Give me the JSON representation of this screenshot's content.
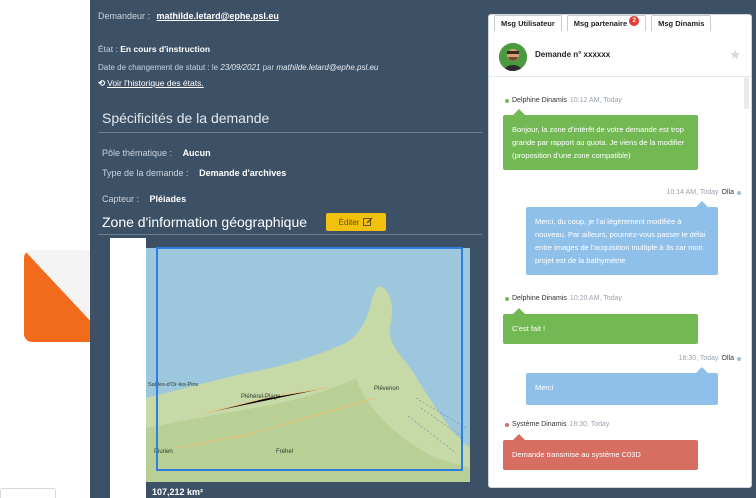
{
  "request": {
    "requester_label": "Demandeur :",
    "requester_email": "mathilde.letard@ephe.psl.eu",
    "state_label": "État :",
    "state_value": "En cours d'instruction",
    "date_prefix": "Date de changement de statut : le",
    "date_value": "23/09/2021",
    "date_by": "par",
    "date_author": "mathilde.letard@ephe.psl.eu",
    "history_link": "Voir l'historique des états."
  },
  "specs": {
    "title": "Spécificités de la demande",
    "theme_label": "Pôle thématique :",
    "theme_value": "Aucun",
    "type_label": "Type de la demande :",
    "type_value": "Demande d'archives",
    "sensor_label": "Capteur :",
    "sensor_value": "Pléiades"
  },
  "geo": {
    "title": "Zone d'information géographique",
    "edit_label": "Éditer",
    "area_value": "107,212 km²",
    "map_places": [
      "Plévenon",
      "Pléhérel-Plage",
      "Sables-d'Or-les-Pins",
      "Plurien",
      "Fréhel"
    ]
  },
  "tabs": [
    {
      "label": "Msg Utilisateur",
      "badge": null
    },
    {
      "label": "Msg partenaire",
      "badge": "2"
    },
    {
      "label": "Msg Dinamis",
      "badge": null
    }
  ],
  "chat": {
    "title": "Demande n° xxxxxx",
    "messages": [
      {
        "author": "Delphine Dinamis",
        "time": "10:12 AM, Today",
        "text": "Bonjour, la zone d'intérêt de votre demande est trop grande par rapport au quota. Je viens de la modifier (proposition d'une zone compatible)",
        "side": "left",
        "color": "#72b954"
      },
      {
        "author": "Olla",
        "time": "10:14 AM, Today",
        "text": "Merci, du coup, je l'ai légèrement modifiée à nouveau. Par ailleurs, pourriez-vous passer le délai entre images de l'acquisition multiple à 3s car mon projet est de la bathymétrie",
        "side": "right",
        "color": "#8fc0ea"
      },
      {
        "author": "Delphine Dinamis",
        "time": "10:20 AM, Today",
        "text": "C'est fait !",
        "side": "left",
        "color": "#72b954"
      },
      {
        "author": "Olla",
        "time": "18:30, Today",
        "text": "Merci",
        "side": "right",
        "color": "#8fc0ea"
      },
      {
        "author": "Système Dinamis",
        "time": "18:30, Today",
        "text": "Demande transmise au système C03D",
        "side": "left",
        "color": "#d76e62"
      }
    ]
  },
  "colors": {
    "panel_bg": "#3d5166",
    "accent_yellow": "#f2c10f",
    "orange_shape": "#f26a1b",
    "area_outline": "#2f7fde",
    "badge_red": "#e53935"
  },
  "icons": [
    "history-icon",
    "edit-icon",
    "star-icon",
    "avatar-image"
  ]
}
